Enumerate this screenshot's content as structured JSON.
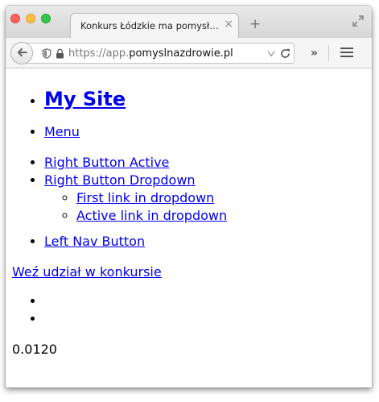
{
  "browser": {
    "tab_title": "Konkurs Łódzkie ma pomysł n...",
    "tab_close": "×",
    "new_tab": "+",
    "url_prefix": "https://app.",
    "url_domain": "pomyslnazdrowie.pl",
    "overflow": "»",
    "icons": [
      "close-window-icon",
      "minimize-window-icon",
      "zoom-window-icon",
      "resize-icon",
      "back-arrow-icon",
      "shield-icon",
      "lock-icon",
      "dropdown-caret-icon",
      "reload-icon",
      "hamburger-menu-icon"
    ]
  },
  "page": {
    "brand": "My Site",
    "menu": "Menu",
    "right_active": "Right Button Active",
    "right_dropdown": "Right Button Dropdown",
    "dropdown_first": "First link in dropdown",
    "dropdown_active": "Active link in dropdown",
    "left_nav": "Left Nav Button",
    "cta": "Weź udział w konkursie",
    "counter": "0.0120"
  }
}
